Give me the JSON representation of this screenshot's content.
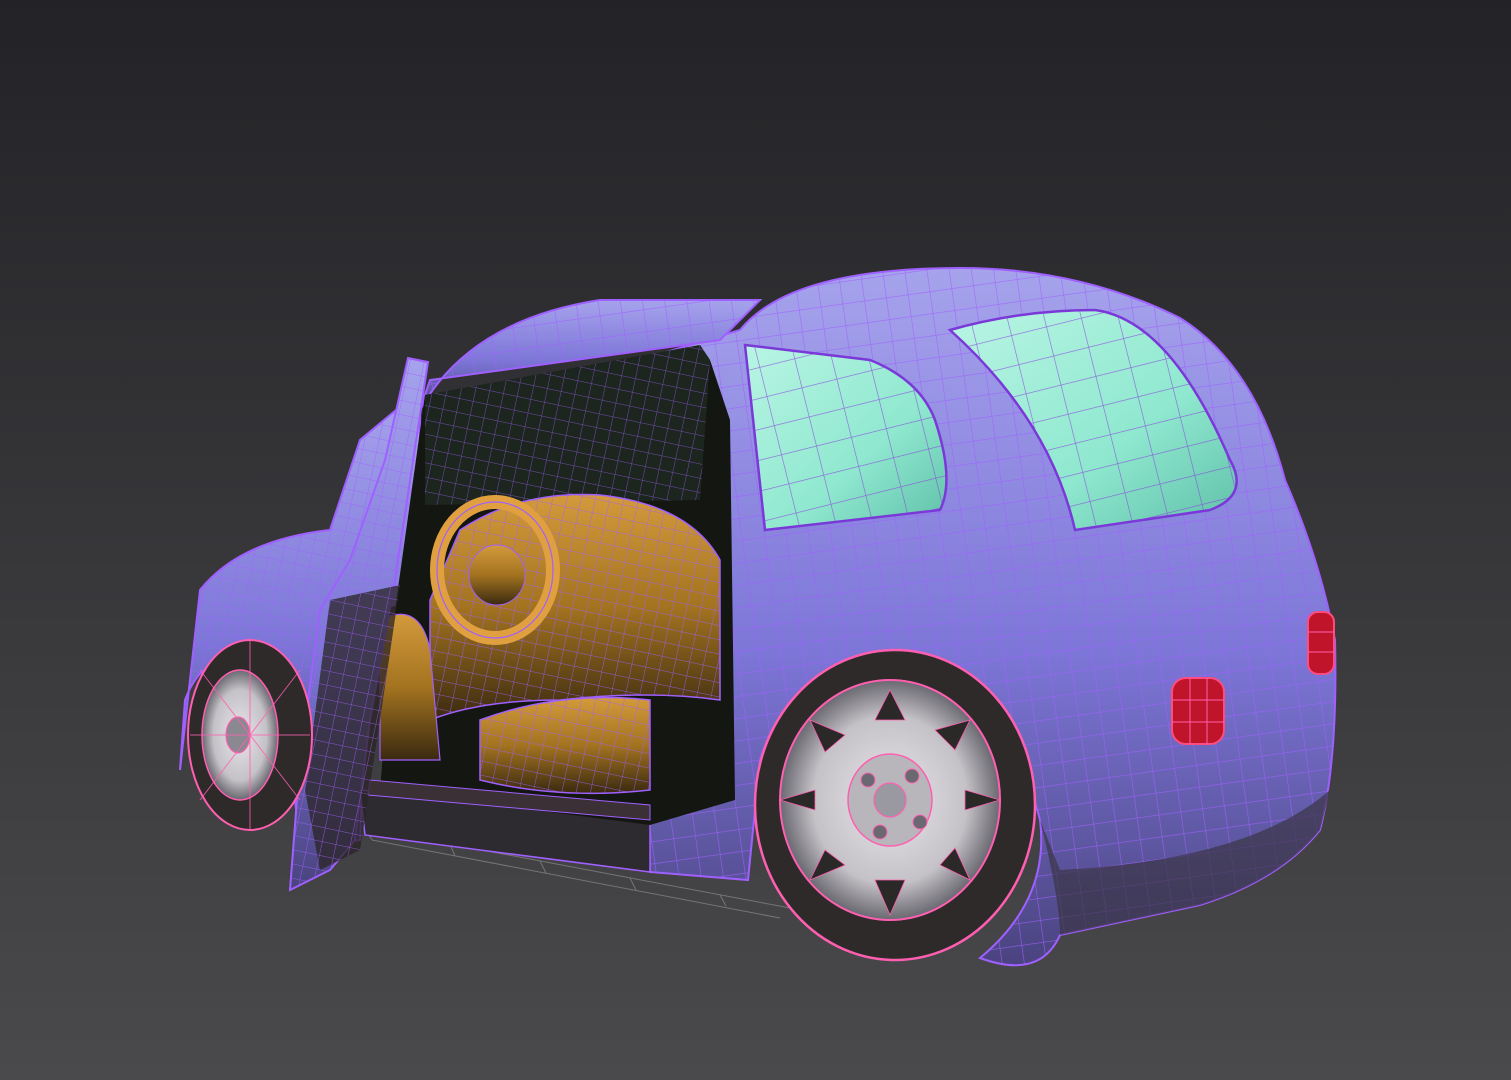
{
  "viewport": {
    "background_top": "#232327",
    "background_bottom": "#4a4a4c"
  },
  "model": {
    "body_color": "#7d76d8",
    "body_highlight": "#a6a3ec",
    "wire_color": "#a060ff",
    "wheel_wire_color": "#ff5fb0",
    "glass_color": "#8fe8cf",
    "interior_color": "#a37320",
    "tail_light_color": "#c0142a",
    "tire_color": "#2e2a2a",
    "rim_color": "#c4c2c6",
    "ground_grid_color": "#8a8a8a"
  }
}
